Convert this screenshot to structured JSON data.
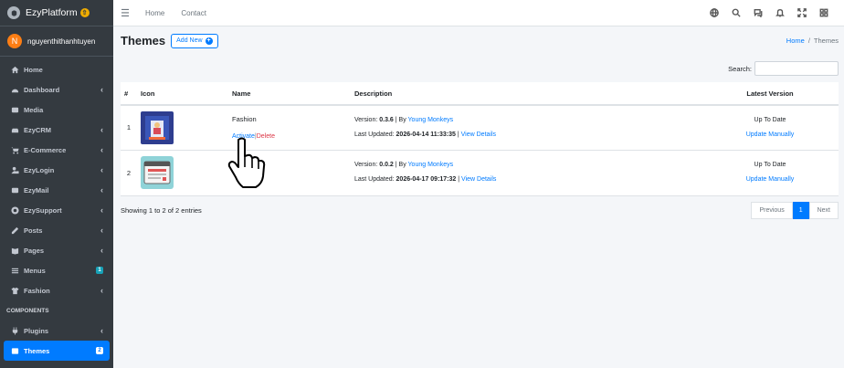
{
  "app": {
    "brand": "EzyPlatform",
    "brand_badge": "⇧",
    "user_initial": "N",
    "user_name": "nguyenthithanhtuyen"
  },
  "sidebar": {
    "items": [
      {
        "label": "Home",
        "icon": "home-icon",
        "chevron": ""
      },
      {
        "label": "Dashboard",
        "icon": "dashboard-icon",
        "chevron": "‹"
      },
      {
        "label": "Media",
        "icon": "media-icon",
        "chevron": ""
      },
      {
        "label": "EzyCRM",
        "icon": "car-icon",
        "chevron": "‹"
      },
      {
        "label": "E-Commerce",
        "icon": "cart-icon",
        "chevron": "‹"
      },
      {
        "label": "EzyLogin",
        "icon": "user-lock-icon",
        "chevron": "‹"
      },
      {
        "label": "EzyMail",
        "icon": "mail-icon",
        "chevron": "‹"
      },
      {
        "label": "EzySupport",
        "icon": "support-icon",
        "chevron": "‹"
      },
      {
        "label": "Posts",
        "icon": "posts-icon",
        "chevron": "‹"
      },
      {
        "label": "Pages",
        "icon": "pages-icon",
        "chevron": "‹"
      },
      {
        "label": "Menus",
        "icon": "menu-icon",
        "badge": "1"
      },
      {
        "label": "Fashion",
        "icon": "shirt-icon",
        "chevron": "‹"
      }
    ],
    "section_header": "COMPONENTS",
    "components": [
      {
        "label": "Plugins",
        "icon": "plug-icon",
        "chevron": "‹"
      },
      {
        "label": "Themes",
        "icon": "themes-icon",
        "badge": "2",
        "active": true
      }
    ]
  },
  "topbar": {
    "links": [
      "Home",
      "Contact"
    ],
    "icons": [
      "globe-icon",
      "search-icon",
      "chat-icon",
      "bell-icon",
      "fullscreen-icon",
      "grid-icon"
    ]
  },
  "page": {
    "title": "Themes",
    "add_new_label": "Add New",
    "breadcrumb": {
      "home": "Home",
      "separator": "/",
      "current": "Themes"
    },
    "search_label": "Search:",
    "search_value": ""
  },
  "table": {
    "headers": {
      "num": "#",
      "icon": "Icon",
      "name": "Name",
      "description": "Description",
      "latest": "Latest Version"
    },
    "rows": [
      {
        "num": "1",
        "name": "Fashion",
        "activate": "Activate",
        "pipe": "|",
        "delete": "Delete",
        "version_prefix": "Version: ",
        "version": "0.3.6",
        "by": " | By ",
        "author": "Young Monkeys",
        "updated_prefix": "Last Updated: ",
        "updated": "2026-04-14 11:33:35",
        "sep": " | ",
        "view_details": "View Details",
        "status": "Up To Date",
        "update_manually": "Update Manually"
      },
      {
        "num": "2",
        "name": "",
        "activate": "",
        "pipe": "",
        "delete": "",
        "version_prefix": "Version: ",
        "version": "0.0.2",
        "by": " | By ",
        "author": "Young Monkeys",
        "updated_prefix": "Last Updated: ",
        "updated": "2026-04-17 09:17:32",
        "sep": " | ",
        "view_details": "View Details",
        "status": "Up To Date",
        "update_manually": "Update Manually"
      }
    ]
  },
  "footer": {
    "entries": "Showing 1 to 2 of 2 entries",
    "previous": "Previous",
    "page": "1",
    "next": "Next"
  },
  "colors": {
    "sidebar_bg": "#343a40",
    "accent": "#007bff",
    "danger": "#dc3545",
    "badge_info": "#17a2b8",
    "brand_badge": "#f0ad00",
    "avatar": "#fd7e14"
  }
}
